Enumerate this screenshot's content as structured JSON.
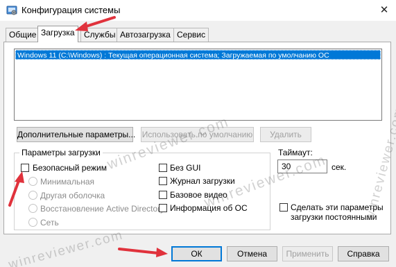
{
  "window": {
    "title": "Конфигурация системы",
    "close_glyph": "✕"
  },
  "tabs": [
    {
      "label": "Общие",
      "active": false
    },
    {
      "label": "Загрузка",
      "active": true
    },
    {
      "label": "Службы",
      "active": false
    },
    {
      "label": "Автозагрузка",
      "active": false
    },
    {
      "label": "Сервис",
      "active": false
    }
  ],
  "os_list": {
    "selected": "Windows 11 (C:\\Windows) : Текущая операционная система; Загружаемая по умолчанию ОС"
  },
  "list_buttons": {
    "advanced": "Дополнительные параметры...",
    "set_default": "Использовать по умолчанию",
    "delete": "Удалить"
  },
  "boot_options": {
    "group_label": "Параметры загрузки",
    "safe_boot": {
      "label": "Безопасный режим",
      "checked": false
    },
    "minimal": "Минимальная",
    "alternate_shell": "Другая оболочка",
    "ad_repair": "Восстановление Active Directory",
    "network": "Сеть",
    "no_gui": {
      "label": "Без GUI",
      "checked": false
    },
    "boot_log": {
      "label": "Журнал загрузки",
      "checked": false
    },
    "base_video": {
      "label": "Базовое видео",
      "checked": false
    },
    "os_info": {
      "label": "Информация  об ОС",
      "checked": false
    }
  },
  "timeout": {
    "label": "Таймаут:",
    "value": "30",
    "unit": "сек."
  },
  "permanent": {
    "line1": "Сделать эти параметры",
    "line2": "загрузки постоянными",
    "checked": false
  },
  "footer": {
    "ok": "ОК",
    "cancel": "Отмена",
    "apply": "Применить",
    "help": "Справка"
  },
  "watermark": "winreviewer.com",
  "colors": {
    "accent": "#0078d7",
    "annotation_arrow": "#e0323c"
  }
}
